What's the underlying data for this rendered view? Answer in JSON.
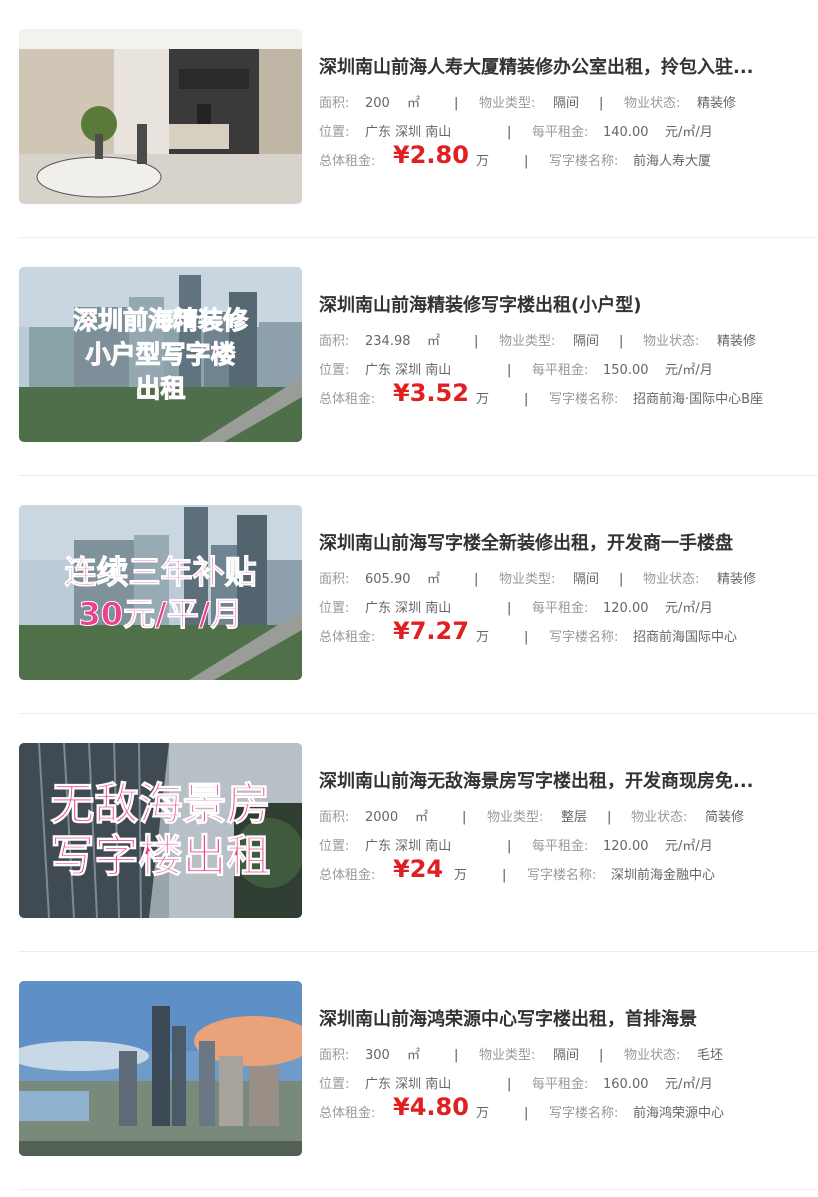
{
  "labels": {
    "area": "面积:",
    "type": "物业类型:",
    "status": "物业状态:",
    "location": "位置:",
    "unit_price": "每平租金:",
    "total": "总体租金:",
    "building": "写字楼名称:",
    "sqm": "㎡",
    "price_unit": "元/㎡/月",
    "wan": "万",
    "separator": "|"
  },
  "listings": [
    {
      "title": "深圳南山前海人寿大厦精装修办公室出租，拎包入驻...",
      "area": "200",
      "type": "隔间",
      "status": "精装修",
      "location": "广东 深圳 南山",
      "unit_price": "140.00",
      "total": "¥2.80",
      "building": "前海人寿大厦",
      "image": "office-lobby-photo",
      "overlay": []
    },
    {
      "title": "深圳南山前海精装修写字楼出租(小户型)",
      "area": "234.98",
      "type": "隔间",
      "status": "精装修",
      "location": "广东 深圳 南山",
      "unit_price": "150.00",
      "total": "¥3.52",
      "building": "招商前海·国际中心B座",
      "image": "city-skyline-photo",
      "overlay": [
        "深圳前海精装修",
        "小户型写字楼",
        "出租"
      ]
    },
    {
      "title": "深圳南山前海写字楼全新装修出租，开发商一手楼盘",
      "area": "605.90",
      "type": "隔间",
      "status": "精装修",
      "location": "广东 深圳 南山",
      "unit_price": "120.00",
      "total": "¥7.27",
      "building": "招商前海国际中心",
      "image": "city-skyline-photo",
      "overlay": [
        "连续三年补贴",
        "30元/平/月"
      ]
    },
    {
      "title": "深圳南山前海无敌海景房写字楼出租，开发商现房免...",
      "area": "2000",
      "type": "整层",
      "status": "简装修",
      "location": "广东 深圳 南山",
      "unit_price": "120.00",
      "total": "¥24",
      "building": "深圳前海金融中心",
      "image": "tower-facade-photo",
      "overlay": [
        "无敌海景房",
        "写字楼出租"
      ]
    },
    {
      "title": "深圳南山前海鸿荣源中心写字楼出租，首排海景",
      "area": "300",
      "type": "隔间",
      "status": "毛坯",
      "location": "广东 深圳 南山",
      "unit_price": "160.00",
      "total": "¥4.80",
      "building": "前海鸿荣源中心",
      "image": "sunset-aerial-photo",
      "overlay": []
    }
  ]
}
